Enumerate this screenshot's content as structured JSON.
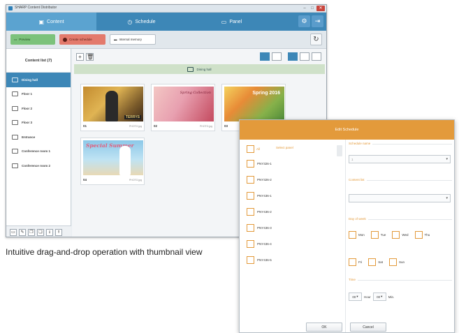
{
  "app": {
    "window_title": "SHARP Content Distributor",
    "nav_tabs": [
      {
        "label": "Content",
        "icon": "image-icon",
        "active": true
      },
      {
        "label": "Schedule",
        "icon": "calendar-icon",
        "active": false
      },
      {
        "label": "Panel",
        "icon": "display-icon",
        "active": false
      }
    ],
    "toolbar": {
      "preview_label": "Preview",
      "create_schedule_label": "Create schedule",
      "internal_memory_label": "Internal memory"
    },
    "sidebar": {
      "title": "Content list (7)",
      "items": [
        {
          "label": "Dining hall",
          "active": true
        },
        {
          "label": "Floor 1",
          "active": false
        },
        {
          "label": "Floor 2",
          "active": false
        },
        {
          "label": "Floor 3",
          "active": false
        },
        {
          "label": "Entrance",
          "active": false
        },
        {
          "label": "Conference room 1",
          "active": false
        },
        {
          "label": "Conference room 2",
          "active": false
        }
      ]
    },
    "content": {
      "group_label": "Dining hall",
      "thumbnails": [
        {
          "num": "01",
          "file": "PHOTO.jpg",
          "overlay": "TERRYS"
        },
        {
          "num": "02",
          "file": "PHOTO.jpg",
          "overlay": "Spring Collection"
        },
        {
          "num": "03",
          "file": "PHOTO.jpg",
          "overlay": "Spring 2016"
        },
        {
          "num": "04",
          "file": "PHOTO.jpg",
          "overlay": "Special Summer"
        }
      ]
    }
  },
  "caption": "Intuitive drag-and-drop operation with thumbnail view",
  "dialog": {
    "title": "Edit Schedule",
    "all_label": "All",
    "select_panel_label": "Select panel",
    "panels": [
      "PNY326-1",
      "PNY326-2",
      "PNY436-1",
      "PNY436-2",
      "PNY436-3",
      "PNY436-4",
      "PNY436-5"
    ],
    "schedule_name_label": "Schedule name",
    "schedule_name_value": "1",
    "content_list_label": "Content list",
    "day_of_week_label": "Day of week",
    "days_row1": [
      "Mon",
      "Tue",
      "Wed",
      "Thu"
    ],
    "days_row2": [
      "Fri",
      "Sat",
      "Sun"
    ],
    "time_label": "Time",
    "hour_value": "00",
    "hour_label": "Hour",
    "min_value": "00",
    "min_label": "Min.",
    "ok_label": "OK",
    "cancel_label": "Cancel"
  },
  "colors": {
    "nav_blue": "#3d87b7",
    "dialog_orange": "#e39a3b",
    "preview_green": "#7cc27b",
    "create_red": "#e37a6c"
  }
}
